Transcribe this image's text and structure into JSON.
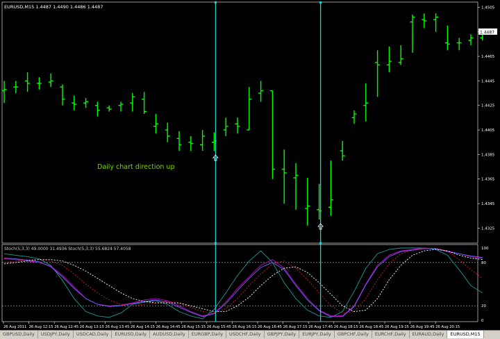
{
  "window": {
    "symbol_header": "EURUSD,M15  1.4487 1.4490 1.4486 1.4487",
    "indicator_header": "Stoch(5,3,3) 49.0000 31.4936  Stoch(5,3,3) 55.6824 57.4058",
    "annotation": "Daily chart direction up",
    "current_price": "1.4487"
  },
  "colors": {
    "background": "#000000",
    "candles": "#00ff00",
    "vlines": "#1fd0d0",
    "axis": "#ffffff",
    "annotation": "#7cd400"
  },
  "chart_data": [
    {
      "type": "ohlc",
      "ylim": [
        1.4315,
        1.4503
      ],
      "y_ticks": [
        "1.4505",
        "1.4485",
        "1.4465",
        "1.4445",
        "1.4425",
        "1.4405",
        "1.4385",
        "1.4365",
        "1.4345",
        "1.4325"
      ],
      "x_ticks": [
        "26 Aug 2011",
        "26 Aug 12:15",
        "26 Aug 12:45",
        "26 Aug 13:15",
        "26 Aug 13:45",
        "26 Aug 14:15",
        "26 Aug 14:45",
        "26 Aug 15:15",
        "26 Aug 15:45",
        "26 Aug 16:15",
        "26 Aug 16:45",
        "26 Aug 17:15",
        "26 Aug 17:45",
        "26 Aug 18:15",
        "26 Aug 18:45",
        "26 Aug 19:15",
        "26 Aug 19:45",
        "26 Aug 20:15"
      ],
      "vertical_lines_at_bar": [
        18,
        27
      ],
      "arrow_markers_at_bar": [
        18,
        27
      ],
      "bars": [
        {
          "o": 1.4437,
          "h": 1.4445,
          "l": 1.4427,
          "c": 1.4438
        },
        {
          "o": 1.444,
          "h": 1.4445,
          "l": 1.4435,
          "c": 1.444
        },
        {
          "o": 1.4445,
          "h": 1.4452,
          "l": 1.4436,
          "c": 1.4443
        },
        {
          "o": 1.4443,
          "h": 1.4448,
          "l": 1.4438,
          "c": 1.4443
        },
        {
          "o": 1.4444,
          "h": 1.4451,
          "l": 1.444,
          "c": 1.4445
        },
        {
          "o": 1.444,
          "h": 1.4442,
          "l": 1.4425,
          "c": 1.443
        },
        {
          "o": 1.4427,
          "h": 1.4433,
          "l": 1.4421,
          "c": 1.4426
        },
        {
          "o": 1.4427,
          "h": 1.4431,
          "l": 1.4423,
          "c": 1.4428
        },
        {
          "o": 1.4425,
          "h": 1.4428,
          "l": 1.4416,
          "c": 1.4421
        },
        {
          "o": 1.4423,
          "h": 1.4425,
          "l": 1.442,
          "c": 1.4422
        },
        {
          "o": 1.4425,
          "h": 1.4428,
          "l": 1.442,
          "c": 1.4426
        },
        {
          "o": 1.4427,
          "h": 1.4435,
          "l": 1.442,
          "c": 1.4432
        },
        {
          "o": 1.443,
          "h": 1.4436,
          "l": 1.4418,
          "c": 1.442
        },
        {
          "o": 1.4408,
          "h": 1.4418,
          "l": 1.4402,
          "c": 1.441
        },
        {
          "o": 1.4405,
          "h": 1.4411,
          "l": 1.4395,
          "c": 1.44
        },
        {
          "o": 1.4398,
          "h": 1.4404,
          "l": 1.4388,
          "c": 1.4393
        },
        {
          "o": 1.4395,
          "h": 1.44,
          "l": 1.4388,
          "c": 1.4394
        },
        {
          "o": 1.4393,
          "h": 1.4405,
          "l": 1.4388,
          "c": 1.44
        },
        {
          "o": 1.4395,
          "h": 1.4403,
          "l": 1.4388,
          "c": 1.4396
        },
        {
          "o": 1.4405,
          "h": 1.4415,
          "l": 1.44,
          "c": 1.4408
        },
        {
          "o": 1.441,
          "h": 1.4415,
          "l": 1.4402,
          "c": 1.4408
        },
        {
          "o": 1.4405,
          "h": 1.444,
          "l": 1.4405,
          "c": 1.443
        },
        {
          "o": 1.4435,
          "h": 1.4445,
          "l": 1.4428,
          "c": 1.4437
        },
        {
          "o": 1.4437,
          "h": 1.4435,
          "l": 1.4365,
          "c": 1.4373
        },
        {
          "o": 1.4373,
          "h": 1.4389,
          "l": 1.4345,
          "c": 1.437
        },
        {
          "o": 1.4366,
          "h": 1.4378,
          "l": 1.434,
          "c": 1.4368
        },
        {
          "o": 1.4341,
          "h": 1.4366,
          "l": 1.4327,
          "c": 1.4343
        },
        {
          "o": 1.434,
          "h": 1.4361,
          "l": 1.4332,
          "c": 1.4339
        },
        {
          "o": 1.4342,
          "h": 1.438,
          "l": 1.4335,
          "c": 1.4348
        },
        {
          "o": 1.4388,
          "h": 1.4396,
          "l": 1.438,
          "c": 1.4384
        },
        {
          "o": 1.4415,
          "h": 1.4421,
          "l": 1.441,
          "c": 1.4418
        },
        {
          "o": 1.4425,
          "h": 1.4443,
          "l": 1.4412,
          "c": 1.4427
        },
        {
          "o": 1.446,
          "h": 1.447,
          "l": 1.4432,
          "c": 1.4458
        },
        {
          "o": 1.4458,
          "h": 1.4473,
          "l": 1.4452,
          "c": 1.4461
        },
        {
          "o": 1.446,
          "h": 1.4474,
          "l": 1.4458,
          "c": 1.4463
        },
        {
          "o": 1.4493,
          "h": 1.4499,
          "l": 1.4468,
          "c": 1.4497
        },
        {
          "o": 1.4495,
          "h": 1.45,
          "l": 1.4488,
          "c": 1.4494
        },
        {
          "o": 1.4495,
          "h": 1.45,
          "l": 1.4485,
          "c": 1.4497
        },
        {
          "o": 1.4476,
          "h": 1.449,
          "l": 1.447,
          "c": 1.4475
        },
        {
          "o": 1.4476,
          "h": 1.448,
          "l": 1.447,
          "c": 1.4476
        },
        {
          "o": 1.4478,
          "h": 1.4483,
          "l": 1.4474,
          "c": 1.448
        },
        {
          "o": 1.448,
          "h": 1.4487,
          "l": 1.4478,
          "c": 1.4484
        },
        {
          "o": 1.4485,
          "h": 1.4487,
          "l": 1.4483,
          "c": 1.4487
        }
      ]
    },
    {
      "type": "line",
      "ylim": [
        0,
        100
      ],
      "y_ticks": [
        "100",
        "80",
        "20",
        "0"
      ],
      "levels": [
        80,
        20
      ],
      "series": [
        {
          "color": "#1a9a9a",
          "style": "solid",
          "values": [
            92,
            90,
            88,
            85,
            76,
            55,
            30,
            12,
            6,
            4,
            10,
            22,
            25,
            27,
            22,
            12,
            6,
            2,
            15,
            38,
            62,
            82,
            96,
            80,
            52,
            30,
            14,
            6,
            4,
            12,
            40,
            72,
            92,
            98,
            100,
            100,
            100,
            98,
            90,
            70,
            48,
            38
          ]
        },
        {
          "color": "#cc00cc",
          "style": "solid",
          "values": [
            85,
            84,
            82,
            80,
            75,
            62,
            46,
            30,
            22,
            20,
            21,
            24,
            28,
            30,
            27,
            20,
            12,
            6,
            10,
            25,
            44,
            60,
            76,
            84,
            72,
            50,
            30,
            14,
            6,
            6,
            20,
            50,
            76,
            90,
            96,
            98,
            100,
            99,
            96,
            92,
            88,
            86
          ]
        },
        {
          "color": "#6666ff",
          "style": "solid",
          "values": [
            86,
            85,
            83,
            81,
            74,
            60,
            44,
            30,
            22,
            19,
            20,
            23,
            26,
            28,
            25,
            18,
            11,
            5,
            9,
            23,
            41,
            58,
            73,
            80,
            70,
            48,
            28,
            13,
            5,
            5,
            19,
            49,
            74,
            88,
            95,
            97,
            99,
            99,
            95,
            92,
            89,
            87
          ]
        },
        {
          "color": "#cc2222",
          "style": "dashed",
          "values": [
            80,
            82,
            84,
            84,
            82,
            76,
            64,
            50,
            38,
            28,
            22,
            20,
            22,
            24,
            26,
            24,
            18,
            12,
            10,
            16,
            30,
            48,
            64,
            78,
            82,
            72,
            56,
            38,
            20,
            10,
            12,
            30,
            56,
            78,
            92,
            97,
            99,
            100,
            96,
            84,
            70,
            58
          ]
        },
        {
          "color": "#ffffff",
          "style": "dashed",
          "values": [
            78,
            80,
            82,
            84,
            84,
            82,
            76,
            68,
            58,
            48,
            38,
            30,
            26,
            24,
            24,
            24,
            20,
            16,
            12,
            12,
            20,
            32,
            48,
            62,
            72,
            74,
            66,
            52,
            36,
            20,
            12,
            14,
            30,
            56,
            76,
            90,
            96,
            98,
            96,
            90,
            86,
            84
          ]
        }
      ]
    }
  ],
  "tabs": [
    {
      "label": "GBPUSD,Daily",
      "active": false
    },
    {
      "label": "USDJPY,Daily",
      "active": false
    },
    {
      "label": "USDCAD,Daily",
      "active": false
    },
    {
      "label": "EURUSD,Daily",
      "active": false
    },
    {
      "label": "AUDUSD,Daily",
      "active": false
    },
    {
      "label": "EURGBP,Daily",
      "active": false
    },
    {
      "label": "USDCHF,Daily",
      "active": false
    },
    {
      "label": "GBPJPY,Daily",
      "active": false
    },
    {
      "label": "EURJPY,Daily",
      "active": false
    },
    {
      "label": "GBPCHF,Daily",
      "active": false
    },
    {
      "label": "EURCHF,Daily",
      "active": false
    },
    {
      "label": "EURAUD,Daily",
      "active": false
    },
    {
      "label": "EURUSD,M15",
      "active": true
    }
  ]
}
